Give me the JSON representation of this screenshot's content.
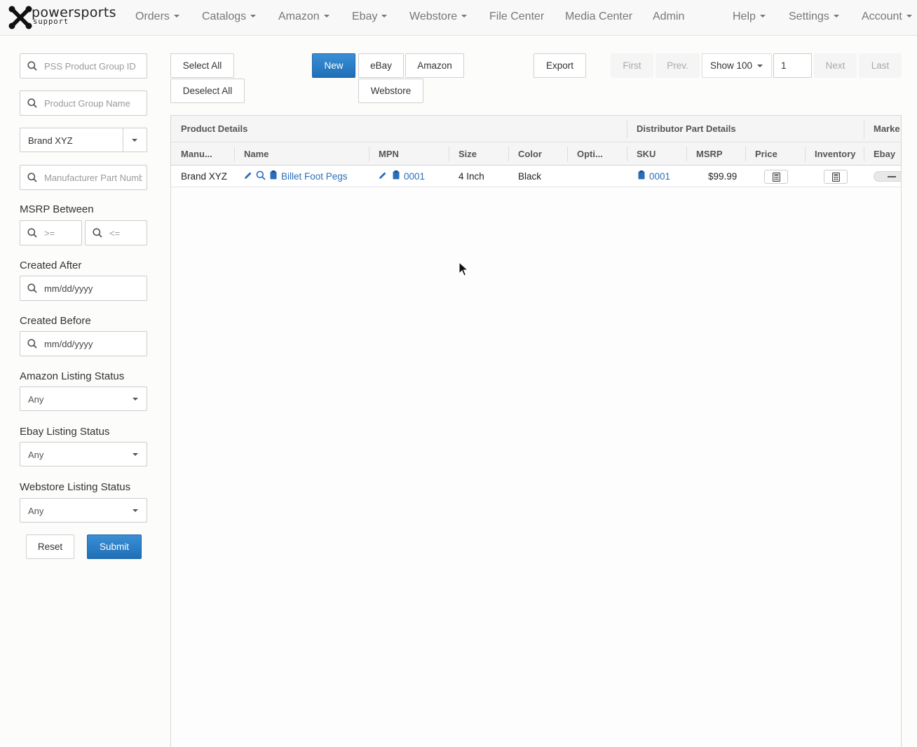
{
  "brand": {
    "name": "powersports",
    "tagline": "support"
  },
  "nav": {
    "left": [
      {
        "label": "Orders",
        "dropdown": true
      },
      {
        "label": "Catalogs",
        "dropdown": true
      },
      {
        "label": "Amazon",
        "dropdown": true
      },
      {
        "label": "Ebay",
        "dropdown": true
      },
      {
        "label": "Webstore",
        "dropdown": true
      },
      {
        "label": "File Center",
        "dropdown": false
      },
      {
        "label": "Media Center",
        "dropdown": false
      },
      {
        "label": "Admin",
        "dropdown": false
      }
    ],
    "right": [
      {
        "label": "Help",
        "dropdown": true
      },
      {
        "label": "Settings",
        "dropdown": true
      },
      {
        "label": "Account",
        "dropdown": true
      }
    ]
  },
  "filters": {
    "product_group_id_placeholder": "PSS Product Group ID",
    "product_group_name_placeholder": "Product Group Name",
    "brand_selected": "Brand XYZ",
    "mpn_placeholder": "Manufacturer Part Number",
    "msrp_label": "MSRP Between",
    "msrp_min_placeholder": ">=",
    "msrp_max_placeholder": "<=",
    "created_after_label": "Created After",
    "created_after_placeholder": "mm/dd/yyyy",
    "created_before_label": "Created Before",
    "created_before_placeholder": "mm/dd/yyyy",
    "amazon_status_label": "Amazon Listing Status",
    "amazon_status_value": "Any",
    "ebay_status_label": "Ebay Listing Status",
    "ebay_status_value": "Any",
    "webstore_status_label": "Webstore Listing Status",
    "webstore_status_value": "Any",
    "reset_label": "Reset",
    "submit_label": "Submit"
  },
  "toolbar": {
    "select_all": "Select All",
    "deselect_all": "Deselect All",
    "new": "New",
    "ebay": "eBay",
    "amazon": "Amazon",
    "webstore": "Webstore",
    "export": "Export",
    "first": "First",
    "prev": "Prev.",
    "page_size": "Show 100",
    "page_number": "1",
    "next": "Next",
    "last": "Last"
  },
  "table": {
    "groups": [
      "Product Details",
      "Distributor Part Details",
      "Marke"
    ],
    "columns": [
      "Manu...",
      "Name",
      "MPN",
      "Size",
      "Color",
      "Opti...",
      "SKU",
      "MSRP",
      "Price",
      "Inventory",
      "Ebay"
    ],
    "rows": [
      {
        "manufacturer": "Brand XYZ",
        "name": "Billet Foot Pegs",
        "mpn": "0001",
        "size": "4 Inch",
        "color": "Black",
        "options": "",
        "sku": "0001",
        "msrp": "$99.99"
      }
    ]
  },
  "colors": {
    "accent": "#1f6fb6",
    "link": "#2a6ebb"
  }
}
